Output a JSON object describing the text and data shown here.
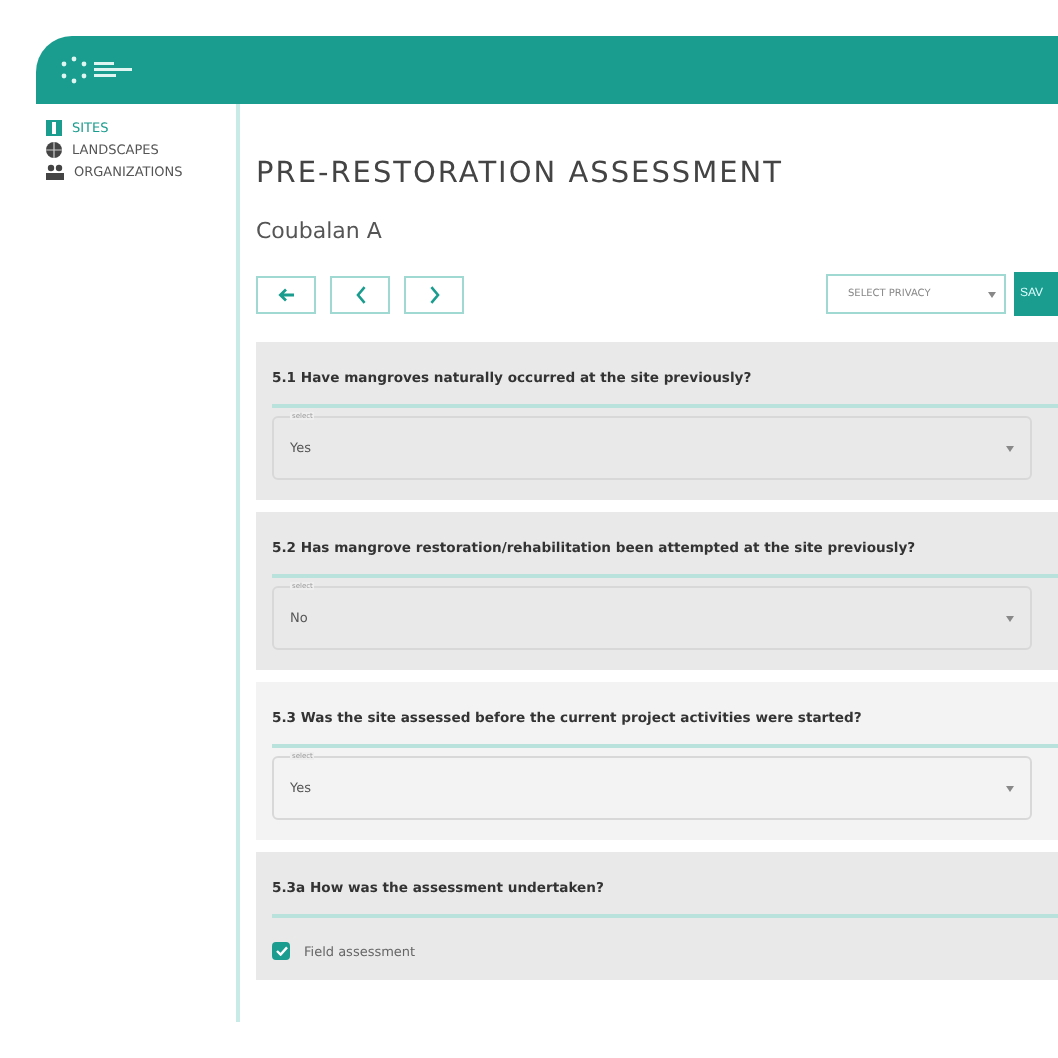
{
  "sidebar": {
    "items": [
      {
        "label": "SITES",
        "kind": "sites",
        "selected": true
      },
      {
        "label": "LANDSCAPES",
        "kind": "landscapes",
        "selected": false
      },
      {
        "label": "ORGANIZATIONS",
        "kind": "organizations",
        "selected": false
      }
    ]
  },
  "page": {
    "title": "PRE-RESTORATION ASSESSMENT",
    "subtitle": "Coubalan A"
  },
  "toolbar": {
    "nav_buttons": [
      {
        "kind": "back"
      },
      {
        "kind": "prev"
      },
      {
        "kind": "next"
      }
    ],
    "privacy_select": {
      "placeholder": "SELECT PRIVACY"
    },
    "save_button": "SAV"
  },
  "questions": [
    {
      "kind": "select",
      "label": "5.1 Have mangroves naturally occurred at the site previously?",
      "field_label": "select",
      "value": "Yes"
    },
    {
      "kind": "select",
      "label": "5.2 Has mangrove restoration/rehabilitation been attempted at the site previously?",
      "field_label": "select",
      "value": "No"
    },
    {
      "kind": "select",
      "label": "5.3 Was the site assessed before the current project activities were started?",
      "field_label": "select",
      "value": "Yes"
    },
    {
      "kind": "checkboxes",
      "label": "5.3a How was the assessment undertaken?",
      "options": [
        {
          "label": "Field assessment",
          "checked": true
        }
      ]
    }
  ]
}
